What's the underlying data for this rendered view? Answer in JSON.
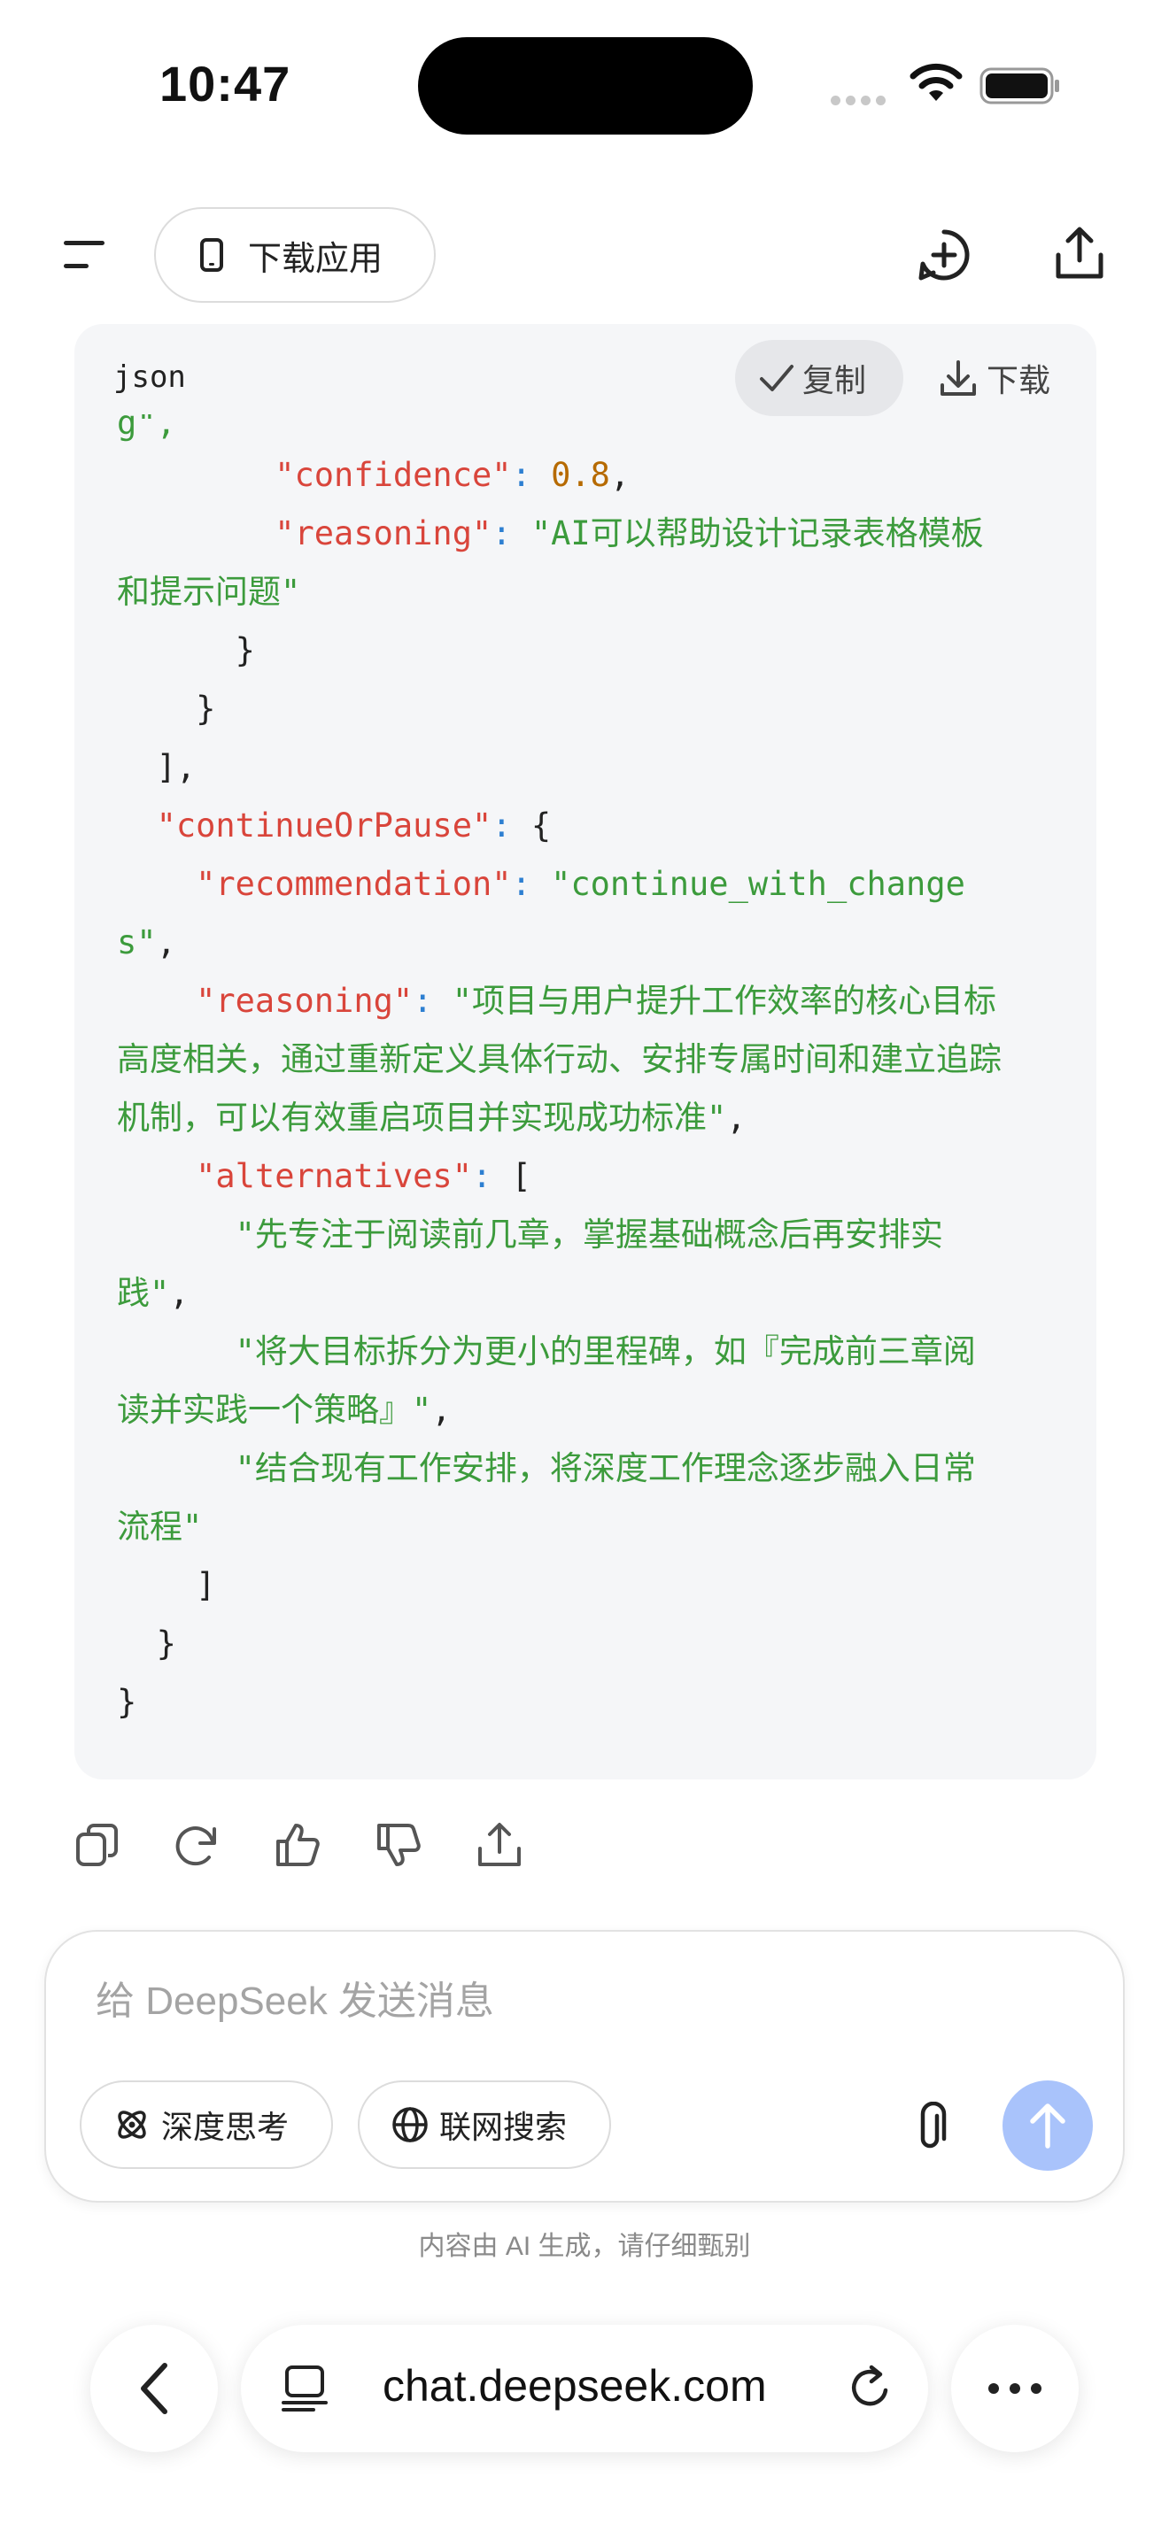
{
  "status_bar": {
    "time": "10:47"
  },
  "header": {
    "download_app_label": "下载应用",
    "icons": [
      "menu-icon",
      "phone-icon",
      "new-chat-icon",
      "share-icon"
    ]
  },
  "code_block": {
    "language": "json",
    "copy_label": "复制",
    "download_label": "下载",
    "cut_line": "g\",",
    "lines": [
      {
        "indent": "        ",
        "key": "\"confidence\"",
        "sep": ": ",
        "val_num": "0.8",
        "tail": ","
      },
      {
        "indent": "        ",
        "key": "\"reasoning\"",
        "sep": ": ",
        "val_str": "\"AI可以帮助设计记录表格模板"
      },
      {
        "indent": "",
        "val_str": "和提示问题\""
      },
      {
        "indent": "      ",
        "punct": "}"
      },
      {
        "indent": "    ",
        "punct": "}"
      },
      {
        "indent": "  ",
        "punct": "],"
      },
      {
        "indent": "  ",
        "key": "\"continueOrPause\"",
        "sep": ": ",
        "punct": "{"
      },
      {
        "indent": "    ",
        "key": "\"recommendation\"",
        "sep": ": ",
        "val_str": "\"continue_with_change"
      },
      {
        "indent": "",
        "val_str": "s\"",
        "tail": ","
      },
      {
        "indent": "    ",
        "key": "\"reasoning\"",
        "sep": ": ",
        "val_str": "\"项目与用户提升工作效率的核心目标"
      },
      {
        "indent": "",
        "val_str": "高度相关，通过重新定义具体行动、安排专属时间和建立追踪"
      },
      {
        "indent": "",
        "val_str": "机制，可以有效重启项目并实现成功标准\"",
        "tail": ","
      },
      {
        "indent": "    ",
        "key": "\"alternatives\"",
        "sep": ": ",
        "punct": "["
      },
      {
        "indent": "      ",
        "val_str": "\"先专注于阅读前几章，掌握基础概念后再安排实"
      },
      {
        "indent": "",
        "val_str": "践\"",
        "tail": ","
      },
      {
        "indent": "      ",
        "val_str": "\"将大目标拆分为更小的里程碑，如『完成前三章阅"
      },
      {
        "indent": "",
        "val_str": "读并实践一个策略』\"",
        "tail": ","
      },
      {
        "indent": "      ",
        "val_str": "\"结合现有工作安排，将深度工作理念逐步融入日常"
      },
      {
        "indent": "",
        "val_str": "流程\""
      },
      {
        "indent": "    ",
        "punct": "]"
      },
      {
        "indent": "  ",
        "punct": "}"
      },
      {
        "indent": "",
        "punct": "}"
      }
    ]
  },
  "message_actions": [
    "copy-icon",
    "regenerate-icon",
    "thumbs-up-icon",
    "thumbs-down-icon",
    "share-icon"
  ],
  "composer": {
    "placeholder": "给 DeepSeek 发送消息",
    "deep_think_label": "深度思考",
    "web_search_label": "联网搜索"
  },
  "disclaimer": "内容由 AI 生成，请仔细甄别",
  "browser": {
    "url": "chat.deepseek.com"
  },
  "colors": {
    "key": "#d9453b",
    "string": "#3c9b3c",
    "number": "#b66a00",
    "colon": "#2d7fd1",
    "send_button": "#a9c3fb"
  }
}
